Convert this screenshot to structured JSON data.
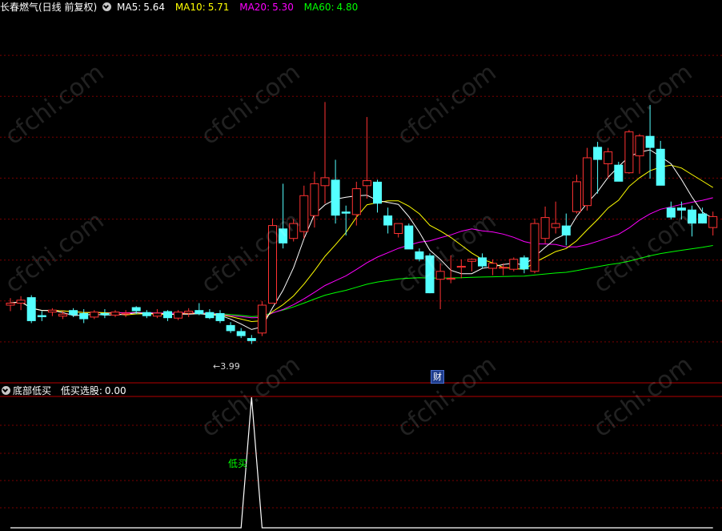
{
  "main_legend": {
    "title": "长春燃气(日线 前复权)",
    "ma": [
      {
        "label": "MA5:",
        "value": "5.64",
        "color": "#ffffff"
      },
      {
        "label": "MA10:",
        "value": "5.71",
        "color": "#ffff00"
      },
      {
        "label": "MA20:",
        "value": "5.30",
        "color": "#ff00ff"
      },
      {
        "label": "MA60:",
        "value": "4.80",
        "color": "#00ff00"
      }
    ]
  },
  "sub_legend": {
    "title": "底部低买",
    "series_label": "低买选股:",
    "value": "0.00"
  },
  "low_marker": "3.99",
  "event_badge": "财",
  "signal_label": "低买",
  "watermark": "cfchi.com",
  "colors": {
    "up": "#ff3232",
    "down": "#54ffff",
    "grid": "#80000",
    "border": "#b40000"
  },
  "chart_data": [
    {
      "type": "candlestick",
      "title": "长春燃气(日线 前复权)",
      "ylim": [
        3.6,
        7.3
      ],
      "ohlc": [
        [
          4.38,
          4.45,
          4.32,
          4.4
        ],
        [
          4.4,
          4.47,
          4.33,
          4.43
        ],
        [
          4.46,
          4.48,
          4.2,
          4.22
        ],
        [
          4.28,
          4.32,
          4.22,
          4.26
        ],
        [
          4.31,
          4.35,
          4.27,
          4.33
        ],
        [
          4.27,
          4.32,
          4.24,
          4.29
        ],
        [
          4.33,
          4.35,
          4.26,
          4.28
        ],
        [
          4.3,
          4.34,
          4.2,
          4.24
        ],
        [
          4.26,
          4.33,
          4.24,
          4.31
        ],
        [
          4.3,
          4.34,
          4.25,
          4.28
        ],
        [
          4.28,
          4.33,
          4.26,
          4.31
        ],
        [
          4.29,
          4.33,
          4.26,
          4.3
        ],
        [
          4.36,
          4.37,
          4.29,
          4.32
        ],
        [
          4.31,
          4.33,
          4.25,
          4.27
        ],
        [
          4.27,
          4.34,
          4.25,
          4.3
        ],
        [
          4.32,
          4.33,
          4.22,
          4.25
        ],
        [
          4.25,
          4.33,
          4.23,
          4.31
        ],
        [
          4.3,
          4.35,
          4.26,
          4.32
        ],
        [
          4.33,
          4.4,
          4.28,
          4.29
        ],
        [
          4.31,
          4.34,
          4.24,
          4.25
        ],
        [
          4.3,
          4.33,
          4.2,
          4.22
        ],
        [
          4.18,
          4.21,
          4.1,
          4.12
        ],
        [
          4.12,
          4.15,
          4.05,
          4.07
        ],
        [
          4.05,
          4.08,
          3.99,
          4.02
        ],
        [
          4.1,
          4.42,
          4.07,
          4.38
        ],
        [
          4.4,
          5.25,
          4.4,
          5.18
        ],
        [
          5.15,
          5.6,
          4.95,
          5.0
        ],
        [
          5.05,
          5.24,
          5.02,
          5.2
        ],
        [
          5.12,
          5.58,
          5.05,
          5.48
        ],
        [
          5.28,
          5.72,
          5.16,
          5.6
        ],
        [
          5.58,
          6.42,
          5.4,
          5.66
        ],
        [
          5.64,
          5.84,
          5.2,
          5.28
        ],
        [
          5.32,
          5.38,
          5.08,
          5.3
        ],
        [
          5.29,
          5.62,
          5.18,
          5.55
        ],
        [
          5.58,
          6.27,
          5.45,
          5.63
        ],
        [
          5.62,
          5.64,
          5.31,
          5.4
        ],
        [
          5.28,
          5.36,
          5.1,
          5.18
        ],
        [
          5.1,
          5.2,
          5.06,
          5.2
        ],
        [
          5.18,
          5.2,
          4.98,
          4.94
        ],
        [
          4.92,
          4.95,
          4.82,
          4.84
        ],
        [
          4.88,
          4.9,
          4.5,
          4.5
        ],
        [
          4.64,
          4.8,
          4.34,
          4.72
        ],
        [
          4.64,
          4.88,
          4.6,
          4.65
        ],
        [
          4.76,
          4.84,
          4.65,
          4.77
        ],
        [
          4.82,
          4.85,
          4.72,
          4.84
        ],
        [
          4.86,
          4.9,
          4.75,
          4.77
        ],
        [
          4.75,
          4.84,
          4.68,
          4.8
        ],
        [
          4.76,
          4.8,
          4.68,
          4.76
        ],
        [
          4.74,
          4.86,
          4.72,
          4.84
        ],
        [
          4.86,
          4.88,
          4.7,
          4.74
        ],
        [
          4.72,
          5.25,
          4.7,
          5.2
        ],
        [
          5.05,
          5.37,
          5.0,
          5.26
        ],
        [
          5.16,
          5.42,
          5.1,
          5.2
        ],
        [
          5.18,
          5.3,
          4.98,
          5.08
        ],
        [
          5.32,
          5.69,
          5.3,
          5.62
        ],
        [
          5.38,
          5.96,
          5.33,
          5.86
        ],
        [
          5.97,
          6.02,
          5.5,
          5.84
        ],
        [
          5.8,
          5.96,
          5.66,
          5.92
        ],
        [
          5.79,
          5.82,
          5.63,
          5.62
        ],
        [
          5.71,
          6.14,
          5.7,
          6.12
        ],
        [
          5.88,
          6.1,
          5.7,
          6.08
        ],
        [
          6.08,
          6.39,
          5.65,
          5.96
        ],
        [
          5.95,
          6.03,
          5.68,
          5.58
        ],
        [
          5.36,
          5.42,
          5.24,
          5.26
        ],
        [
          5.36,
          5.42,
          5.24,
          5.33
        ],
        [
          5.34,
          5.38,
          5.07,
          5.2
        ],
        [
          5.3,
          5.36,
          5.2,
          5.2
        ],
        [
          5.16,
          5.32,
          5.08,
          5.27
        ]
      ]
    },
    {
      "type": "line",
      "title": "底部低买",
      "series": [
        {
          "name": "低买选股",
          "values": [
            0,
            0,
            0,
            0,
            0,
            0,
            0,
            0,
            0,
            0,
            0,
            0,
            0,
            0,
            0,
            0,
            0,
            0,
            0,
            0,
            0,
            0,
            0,
            1,
            0,
            0,
            0,
            0,
            0,
            0,
            0,
            0,
            0,
            0,
            0,
            0,
            0,
            0,
            0,
            0,
            0,
            0,
            0,
            0,
            0,
            0,
            0,
            0,
            0,
            0,
            0,
            0,
            0,
            0,
            0,
            0,
            0,
            0,
            0,
            0,
            0,
            0,
            0,
            0,
            0,
            0,
            0,
            0
          ]
        }
      ],
      "ylim": [
        0,
        1
      ]
    }
  ]
}
